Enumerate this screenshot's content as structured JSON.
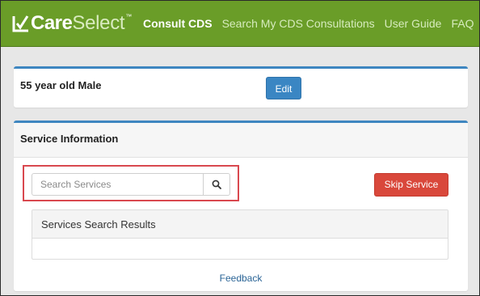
{
  "brand": {
    "care": "Care",
    "select": "Select",
    "tm": "™",
    "icon": "checkmark-logo-icon"
  },
  "nav": {
    "items": [
      {
        "label": "Consult CDS",
        "active": true
      },
      {
        "label": "Search My CDS Consultations",
        "active": false
      },
      {
        "label": "User Guide",
        "active": false
      },
      {
        "label": "FAQ",
        "active": false
      }
    ]
  },
  "patient": {
    "summary": "55 year old Male",
    "edit_label": "Edit"
  },
  "service": {
    "title": "Service Information",
    "search_placeholder": "Search Services",
    "search_icon": "search-icon",
    "skip_label": "Skip Service",
    "results_title": "Services Search Results",
    "feedback_label": "Feedback"
  },
  "colors": {
    "navbar": "#6a9d28",
    "panel_accent": "#3e86c0",
    "edit_button": "#3a86c3",
    "skip_button": "#d9483b",
    "highlight": "#d9484f",
    "link": "#2a6496"
  }
}
